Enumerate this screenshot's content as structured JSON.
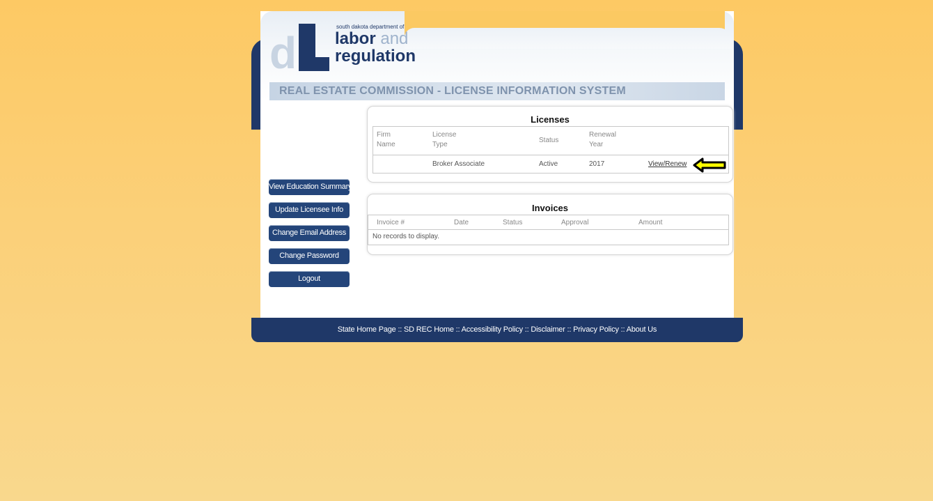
{
  "logo": {
    "small_text": "south dakota department of",
    "word1": "labor",
    "word2": "and",
    "word3": "regulation"
  },
  "system_title": "REAL ESTATE COMMISSION - LICENSE INFORMATION SYSTEM",
  "sidebar": {
    "buttons": [
      {
        "label": "View Education Summary"
      },
      {
        "label": "Update Licensee Info"
      },
      {
        "label": "Change Email Address"
      },
      {
        "label": "Change Password"
      },
      {
        "label": "Logout"
      }
    ]
  },
  "licenses": {
    "title": "Licenses",
    "headers": {
      "firm_line1": "Firm",
      "firm_line2": "Name",
      "type_line1": "License",
      "type_line2": "Type",
      "status": "Status",
      "renewal_line1": "Renewal",
      "renewal_line2": "Year"
    },
    "rows": [
      {
        "firm": "",
        "type": "Broker Associate",
        "status": "Active",
        "year": "2017",
        "action": "View/Renew"
      }
    ]
  },
  "invoices": {
    "title": "Invoices",
    "headers": {
      "invoice": "Invoice #",
      "date": "Date",
      "status": "Status",
      "approval": "Approval",
      "amount": "Amount"
    },
    "empty_message": "No records to display."
  },
  "footer": {
    "links_text": "State Home Page :: SD REC Home :: Accessibility Policy :: Disclaimer :: Privacy Policy :: About Us"
  },
  "colors": {
    "navy": "#1f3868",
    "button": "#24457a",
    "arrow_fill": "#ffff00",
    "background": "#fbcf74"
  },
  "icons": {
    "arrow": "left-arrow-icon"
  }
}
